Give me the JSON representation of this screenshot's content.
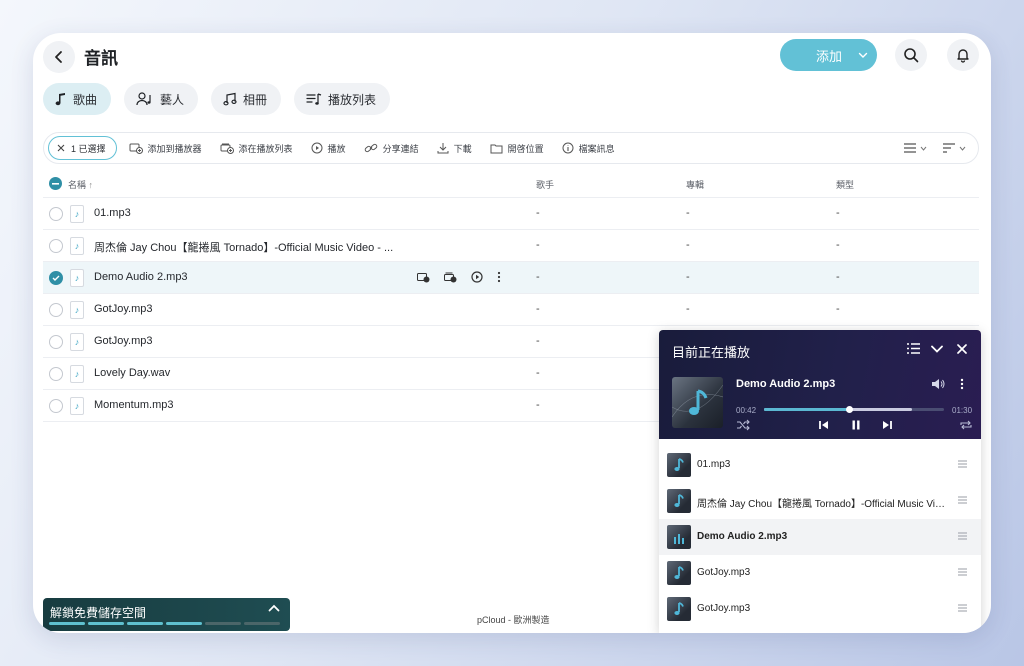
{
  "header": {
    "back": "‹",
    "title": "音訊",
    "add_label": "添加"
  },
  "tabs": [
    {
      "label": "歌曲",
      "icon": "music-note-icon",
      "active": true
    },
    {
      "label": "藝人",
      "icon": "artist-icon",
      "active": false
    },
    {
      "label": "相冊",
      "icon": "album-icon",
      "active": false
    },
    {
      "label": "播放列表",
      "icon": "playlist-icon",
      "active": false
    }
  ],
  "toolbar": {
    "selected": "1 已選擇",
    "add_to_player": "添加到播放器",
    "add_to_playlist": "添在播放列表",
    "play": "播放",
    "share_link": "分享連結",
    "download": "下載",
    "open_location": "開啓位置",
    "file_info": "檔案訊息"
  },
  "table": {
    "columns": {
      "name": "名稱",
      "sort": "↑",
      "artist": "歌手",
      "album": "專輯",
      "genre": "類型"
    },
    "rows": [
      {
        "name": "01.mp3",
        "artist": "-",
        "album": "-",
        "genre": "-",
        "selected": false
      },
      {
        "name": "周杰倫 Jay Chou【龍捲風 Tornado】-Official Music Video - ...",
        "artist": "-",
        "album": "-",
        "genre": "-",
        "selected": false
      },
      {
        "name": "Demo Audio 2.mp3",
        "artist": "-",
        "album": "-",
        "genre": "-",
        "selected": true
      },
      {
        "name": "GotJoy.mp3",
        "artist": "-",
        "album": "-",
        "genre": "-",
        "selected": false
      },
      {
        "name": "GotJoy.mp3",
        "artist": "-",
        "album": "",
        "genre": "",
        "selected": false
      },
      {
        "name": "Lovely Day.wav",
        "artist": "-",
        "album": "",
        "genre": "",
        "selected": false
      },
      {
        "name": "Momentum.mp3",
        "artist": "-",
        "album": "",
        "genre": "",
        "selected": false
      }
    ]
  },
  "unlock": {
    "label": "解鎖免費儲存空間",
    "progress_steps": 6,
    "progress_done": 4
  },
  "footer": "pCloud - 歐洲製造",
  "player": {
    "title": "目前正在播放",
    "track": "Demo Audio 2.mp3",
    "elapsed": "00:42",
    "duration": "01:30",
    "progress": 0.47,
    "buffered": 0.82,
    "queue": [
      {
        "name": "01.mp3",
        "current": false
      },
      {
        "name": "周杰倫 Jay Chou【龍捲風 Tornado】-Official Music Video - ...",
        "current": false
      },
      {
        "name": "Demo Audio 2.mp3",
        "current": true
      },
      {
        "name": "GotJoy.mp3",
        "current": false
      },
      {
        "name": "GotJoy.mp3",
        "current": false
      }
    ]
  },
  "colors": {
    "accent": "#62c1d6",
    "selected_check": "#2f8fa6",
    "player_bg": "#1c1d40"
  }
}
